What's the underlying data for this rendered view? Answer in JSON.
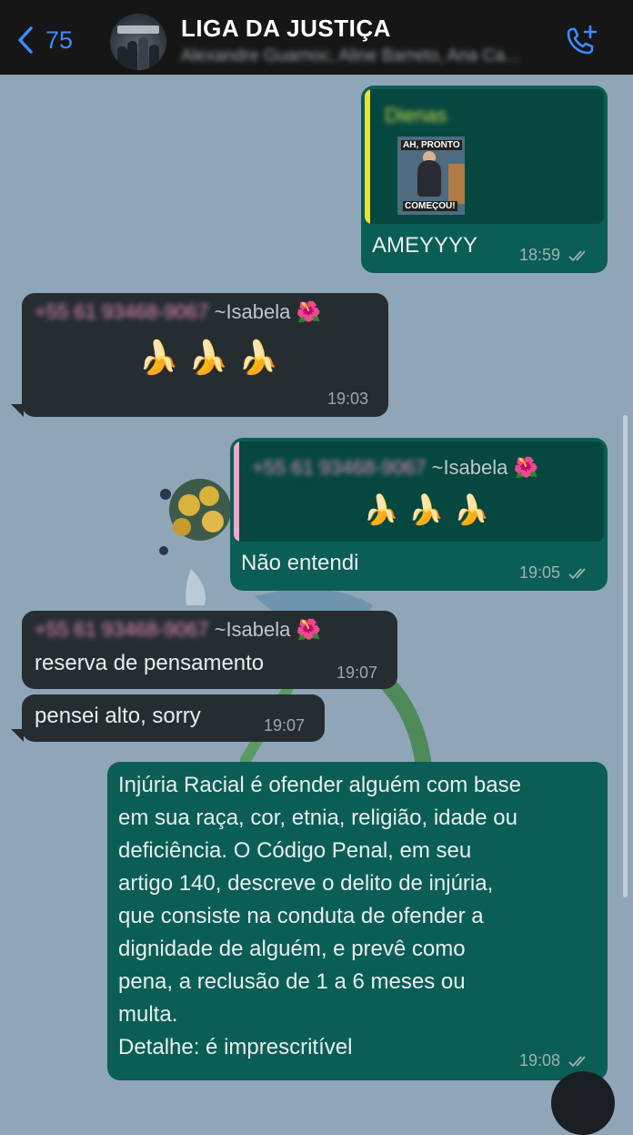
{
  "header": {
    "back_count": "75",
    "title": "LIGA DA JUSTIÇA",
    "members": "Alexandre Guarnoc, Aline Barreto, Ana Ca..."
  },
  "messages": {
    "m1": {
      "quoted_sender": "Dienas",
      "meme_caption_top": "AH, PRONTO",
      "meme_caption_bottom": "COMEÇOU!",
      "text": "AMEYYYY",
      "time": "18:59"
    },
    "m2": {
      "sender_phone": "+55 61 93468-9067",
      "sender_name": "~Isabela",
      "sender_emoji": "🌺",
      "text": "🍌🍌🍌",
      "time": "19:03"
    },
    "m3": {
      "quoted_sender_phone": "+55 61 93468-9067",
      "quoted_sender_name": "~Isabela",
      "quoted_sender_emoji": "🌺",
      "quoted_text": "🍌🍌🍌",
      "text": "Não entendi",
      "time": "19:05"
    },
    "m4": {
      "sender_phone": "+55 61 93468-9067",
      "sender_name": "~Isabela",
      "sender_emoji": "🌺",
      "text": "reserva de pensamento",
      "time": "19:07"
    },
    "m5": {
      "text": "pensei alto, sorry",
      "time": "19:07"
    },
    "m6": {
      "lines": [
        "Injúria Racial é ofender alguém com base",
        "em sua raça, cor, etnia, religião, idade ou",
        "deficiência. O Código Penal, em seu",
        "artigo 140, descreve o delito de injúria,",
        "que consiste na conduta de ofender a",
        "dignidade de alguém, e prevê como",
        "pena, a reclusão de 1 a 6 meses ou",
        "multa.",
        "Detalhe: é imprescritível"
      ],
      "time": "19:08"
    }
  },
  "icons": {
    "back": "chevron-left-icon",
    "call": "add-call-icon",
    "read": "double-check-icon",
    "reaction": "hibiscus-emoji"
  },
  "colors": {
    "wallpaper": "#8fa6b8",
    "outgoing_bubble": "#0b5e55",
    "incoming_bubble": "#262d31",
    "accent_blue": "#3d8bff",
    "quote_bar_yellow": "#e8e23a",
    "quote_bar_pink": "#f2a7c6"
  }
}
